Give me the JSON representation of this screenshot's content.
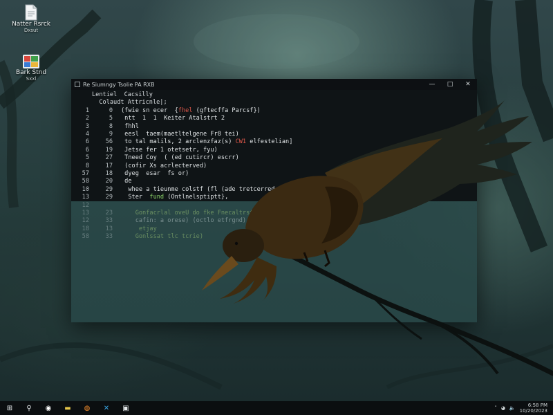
{
  "desktop": {
    "icons": [
      {
        "label": "Natter Rsrck",
        "sublabel": "Dxsut",
        "icon": "document-icon"
      },
      {
        "label": "Bark Stnd",
        "sublabel": "Sxxl",
        "icon": "image-app-icon"
      }
    ]
  },
  "window": {
    "title": "Re Siumngy Tsolie  PA RXB",
    "controls": [
      "minimize",
      "maximize",
      "close"
    ],
    "terminal": {
      "header_lines": [
        "Lentiel  Cacsilly",
        "  Colaudt Attricnle|;"
      ],
      "lines": [
        {
          "n1": "1",
          "n2": "0",
          "code": "(fwie sn ecer  {fhel (gftecffa Parcsf})",
          "hl": "fhel",
          "hl_color": "red"
        },
        {
          "n1": "2",
          "n2": "5",
          "code": " ntt  1  1  Keiter Atalstrt 2",
          "hl": "",
          "hl_color": ""
        },
        {
          "n1": "3",
          "n2": "8",
          "code": " fhhl",
          "hl": "",
          "hl_color": ""
        },
        {
          "n1": "4",
          "n2": "9",
          "code": " eesl  taem(maetltelgene Fr8 tei)",
          "hl": "",
          "hl_color": ""
        },
        {
          "n1": "6",
          "n2": "56",
          "code": " to tal malils, 2 arclenzfaz(s) CW1 elfestelian]",
          "hl": "CW1",
          "hl_color": "red"
        },
        {
          "n1": "6",
          "n2": "19",
          "code": " Jetse fer 1 otetsetr, fyu)",
          "hl": "",
          "hl_color": ""
        },
        {
          "n1": "5",
          "n2": "27",
          "code": " Tneed Coy  ( (ed cutircr) escrr)",
          "hl": "",
          "hl_color": ""
        },
        {
          "n1": "8",
          "n2": "17",
          "code": " (cofir Xs acrlecterved)",
          "hl": "",
          "hl_color": ""
        },
        {
          "n1": "57",
          "n2": "18",
          "code": " dyeg  esar  fs or)",
          "hl": "",
          "hl_color": ""
        },
        {
          "n1": "58",
          "n2": "20",
          "code": " de",
          "hl": "",
          "hl_color": ""
        },
        {
          "n1": "10",
          "n2": "29",
          "code": "  whee a tieunme colstf (fl (ade tretcerred In A))",
          "hl": "",
          "hl_color": ""
        },
        {
          "n1": "13",
          "n2": "29",
          "code": "  Ster  fund (Ontlnelsptiptt},",
          "hl": "fund",
          "hl_color": "green"
        },
        {
          "n1": "12",
          "n2": "",
          "code": "",
          "hl": "",
          "hl_color": ""
        },
        {
          "n1": "13",
          "n2": "23",
          "code": "    Gonfacrlal oveU do fke Fnecaltrst waee",
          "hl": "",
          "hl_color": "",
          "green": true
        },
        {
          "n1": "12",
          "n2": "33",
          "code": "    cafin: a orese) (octlo etfrgnd)",
          "hl": "",
          "hl_color": ""
        },
        {
          "n1": "18",
          "n2": "13",
          "code": "     etjay",
          "hl": "",
          "hl_color": "",
          "green": true
        },
        {
          "n1": "58",
          "n2": "33",
          "code": "    Gonlssat tlc tcrie)",
          "hl": "",
          "hl_color": "",
          "green": true
        }
      ]
    }
  },
  "taskbar": {
    "items": [
      {
        "name": "start-button",
        "glyph": "⊞"
      },
      {
        "name": "search-button",
        "glyph": "⚲"
      },
      {
        "name": "browser-button",
        "glyph": "◉"
      },
      {
        "name": "file-explorer-button",
        "glyph": "▬"
      },
      {
        "name": "app-orange-button",
        "glyph": "◍"
      },
      {
        "name": "app-blue-button",
        "glyph": "✕"
      },
      {
        "name": "app-window-button",
        "glyph": "▣"
      }
    ],
    "clock_time": "6:58 PM",
    "clock_date": "10/20/2023"
  },
  "colors": {
    "terminal_bg": "#0f1416",
    "titlebar_bg": "#0d1013",
    "taskbar_bg": "#0b0e10",
    "highlight_red": "#e0584a",
    "highlight_green": "#8fd86b"
  }
}
